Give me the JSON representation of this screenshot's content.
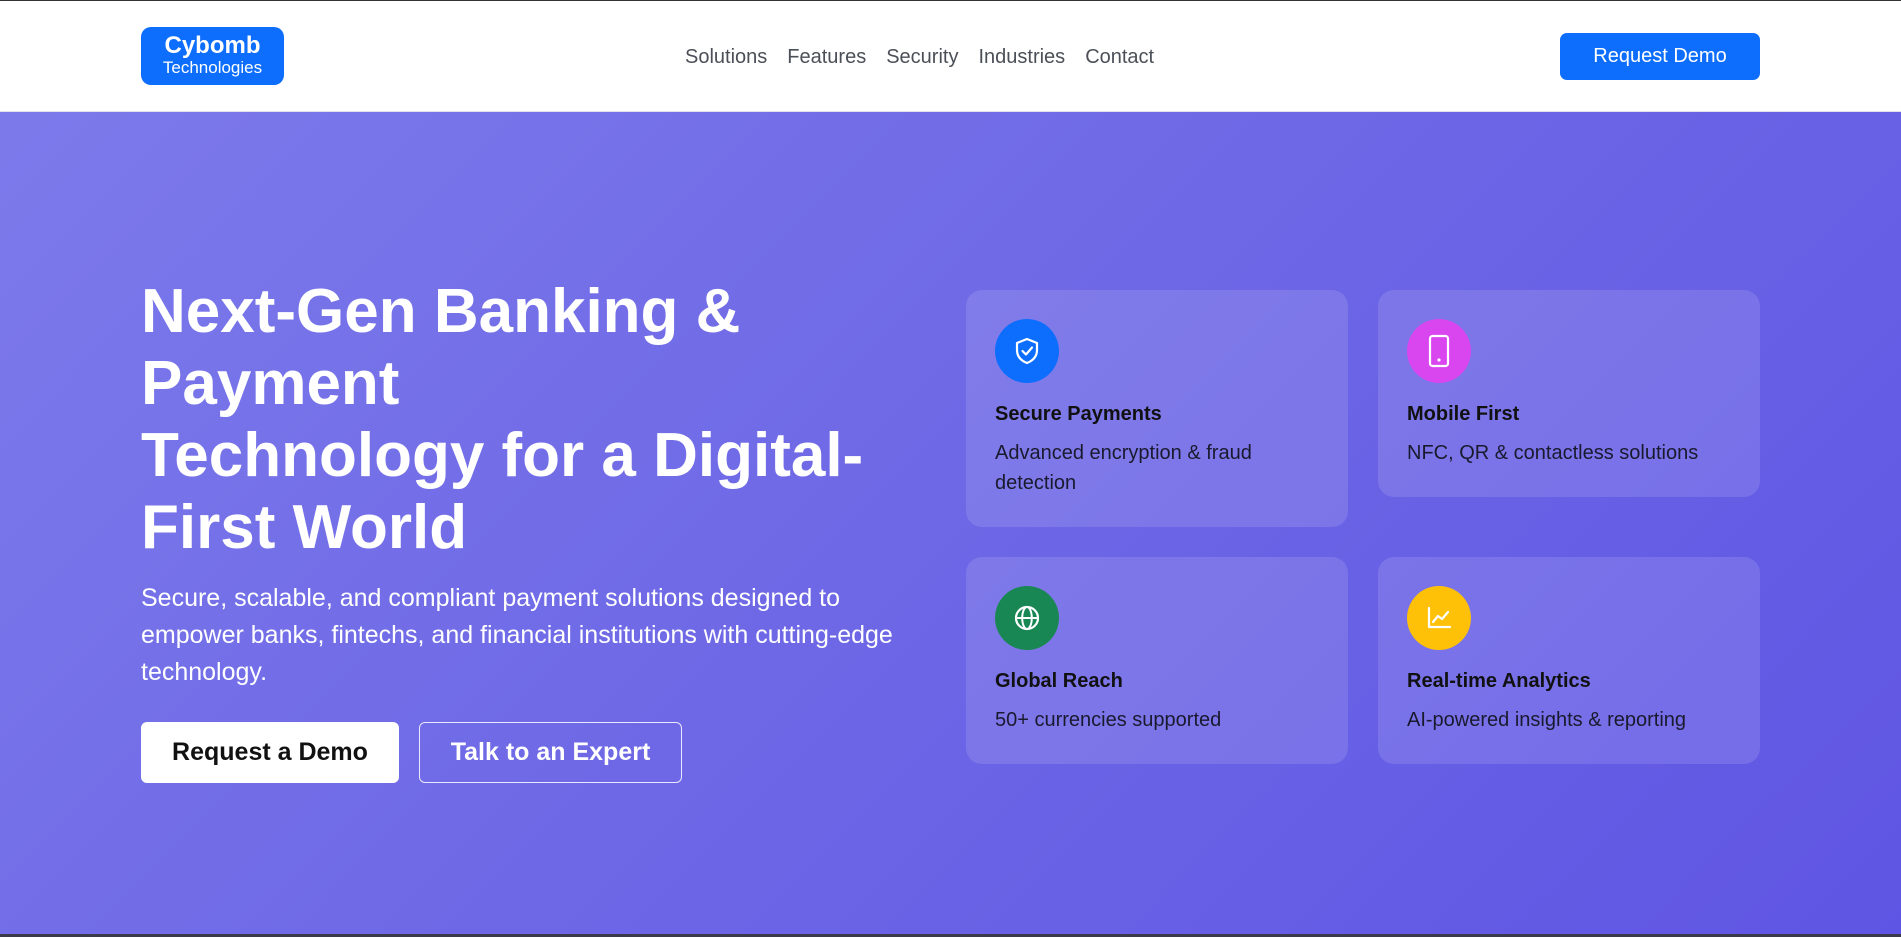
{
  "header": {
    "logo": {
      "name": "Cybomb",
      "sub": "Technologies"
    },
    "nav": [
      {
        "label": "Solutions"
      },
      {
        "label": "Features"
      },
      {
        "label": "Security"
      },
      {
        "label": "Industries"
      },
      {
        "label": "Contact"
      }
    ],
    "cta_label": "Request Demo"
  },
  "hero": {
    "title_lines": [
      "Next-Gen Banking &",
      "Payment",
      "Technology for a Digital-",
      "First World"
    ],
    "subtitle": "Secure, scalable, and compliant payment solutions designed to empower banks, fintechs, and financial institutions with cutting-edge technology.",
    "primary_button": "Request a Demo",
    "secondary_button": "Talk to an Expert"
  },
  "features": [
    {
      "title": "Secure Payments",
      "desc": "Advanced encryption & fraud detection",
      "icon": "shield-icon",
      "color": "#0d6efd"
    },
    {
      "title": "Mobile First",
      "desc": "NFC, QR & contactless solutions",
      "icon": "mobile-icon",
      "color": "#d946ef"
    },
    {
      "title": "Global Reach",
      "desc": "50+ currencies supported",
      "icon": "globe-icon",
      "color": "#198754"
    },
    {
      "title": "Real-time Analytics",
      "desc": "AI-powered insights & reporting",
      "icon": "chart-icon",
      "color": "#ffc107"
    }
  ],
  "colors": {
    "brand": "#0d6efd",
    "hero_gradient_start": "#7c7aeb",
    "hero_gradient_end": "#5f55e4"
  }
}
